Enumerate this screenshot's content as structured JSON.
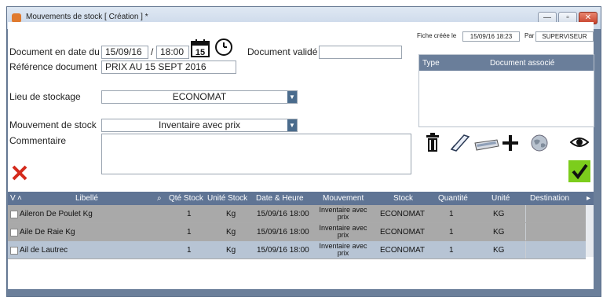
{
  "window": {
    "title": "Mouvements de stock  [ Création ] *",
    "minimize": "—",
    "maximize": "▫",
    "close": "✕"
  },
  "meta": {
    "created_label": "Fiche créée le",
    "created_value": "15/09/16 18:23",
    "by_label": "Par",
    "by_value": "SUPERVISEUR"
  },
  "form": {
    "date_label": "Document en date du",
    "date_value": "15/09/16",
    "date_sep": "/",
    "time_value": "18:00",
    "calendar_day": "15",
    "validated_label": "Document validé",
    "validated_value": "",
    "reference_label": "Référence document",
    "reference_value": "PRIX AU 15 SEPT 2016",
    "storage_label": "Lieu de stockage",
    "storage_value": "ECONOMAT",
    "movement_label": "Mouvement de stock",
    "movement_value": "Inventaire avec prix",
    "comment_label": "Commentaire",
    "comment_value": ""
  },
  "linked_panel": {
    "col_type": "Type",
    "col_doc": "Document associé"
  },
  "grid": {
    "headers": {
      "v": "V",
      "libelle": "Libellé",
      "qte": "Qté Stock",
      "unite_stock": "Unité Stock",
      "date": "Date & Heure",
      "mouvement": "Mouvement",
      "stock": "Stock",
      "quantite": "Quantité",
      "unite": "Unité",
      "destination": "Destination"
    },
    "rows": [
      {
        "libelle": "Aileron De Poulet Kg",
        "qte": "1",
        "unite_stock": "Kg",
        "date": "15/09/16 18:00",
        "mouvement": "Inventaire avec prix",
        "stock": "ECONOMAT",
        "quantite": "1",
        "unite": "KG",
        "destination": ""
      },
      {
        "libelle": "Aile De Raie Kg",
        "qte": "1",
        "unite_stock": "Kg",
        "date": "15/09/16 18:00",
        "mouvement": "Inventaire avec prix",
        "stock": "ECONOMAT",
        "quantite": "1",
        "unite": "KG",
        "destination": ""
      },
      {
        "libelle": "Ail de Lautrec",
        "qte": "1",
        "unite_stock": "Kg",
        "date": "15/09/16 18:00",
        "mouvement": "Inventaire avec prix",
        "stock": "ECONOMAT",
        "quantite": "1",
        "unite": "KG",
        "destination": ""
      }
    ]
  },
  "icons": [
    "trash-icon",
    "edit-icon",
    "scanner-icon",
    "add-icon",
    "globe-icon",
    "eye-icon",
    "cancel-icon",
    "validate-icon",
    "calendar-icon",
    "clock-icon"
  ],
  "colors": {
    "header_bg": "#5f7494",
    "row_gray": "#a9a9a9",
    "row_selected": "#b7c4d4",
    "cancel_red": "#d42a1c",
    "validate_green": "#7ccd1c"
  }
}
